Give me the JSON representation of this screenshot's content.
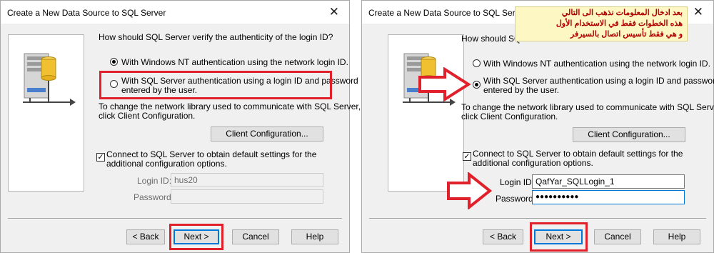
{
  "left_dialog": {
    "title": "Create a New Data Source to SQL Server",
    "question": "How should SQL Server verify the authenticity of the login ID?",
    "option_nt": "With Windows NT authentication using the network login ID.",
    "option_sql_line1": "With SQL Server authentication using a login ID and password",
    "option_sql_line2": "entered by the user.",
    "selected_option": "nt",
    "network_text_line1": "To change the network library used to communicate with SQL Server,",
    "network_text_line2": "click Client Configuration.",
    "client_config_button": "Client Configuration...",
    "connect_line1": "Connect to SQL Server to obtain default settings for the",
    "connect_line2": "additional configuration options.",
    "connect_checked": true,
    "login_id_label": "Login ID:",
    "login_id_value": "hus20",
    "password_label": "Password:",
    "password_value": "",
    "back_button": "< Back",
    "next_button": "Next >",
    "cancel_button": "Cancel",
    "help_button": "Help"
  },
  "right_dialog": {
    "title": "Create a New Data Source to SQL Server",
    "question": "How should SQL S",
    "option_nt": "With Windows NT authentication using the network login ID.",
    "option_sql_line1": "With SQL Server authentication using a login ID and password",
    "option_sql_line2": "entered by the user.",
    "selected_option": "sql",
    "network_text_line1": "To change the network library used to communicate with SQL Server,",
    "network_text_line2": "click Client Configuration.",
    "client_config_button": "Client Configuration...",
    "connect_line1": "Connect to SQL Server to obtain default settings for the",
    "connect_line2": "additional configuration options.",
    "connect_checked": true,
    "login_id_label": "Login ID:",
    "login_id_value": "QafYar_SQLLogin_1",
    "password_label": "Password:",
    "password_value": "●●●●●●●●●●",
    "back_button": "< Back",
    "next_button": "Next >",
    "cancel_button": "Cancel",
    "help_button": "Help",
    "annotation": [
      "بعد ادخال المعلومات نذهب الى التالي",
      "هذه الخطوات فقط في الاستخدام الأول",
      "و هي فقط تأسيس اتصال بالسيرفر"
    ]
  },
  "close_glyph": "✕",
  "check_glyph": "✓",
  "colors": {
    "highlight_red": "#e0202a",
    "annotation_text": "#b00000",
    "annotation_bg": "#fdf7c4"
  }
}
